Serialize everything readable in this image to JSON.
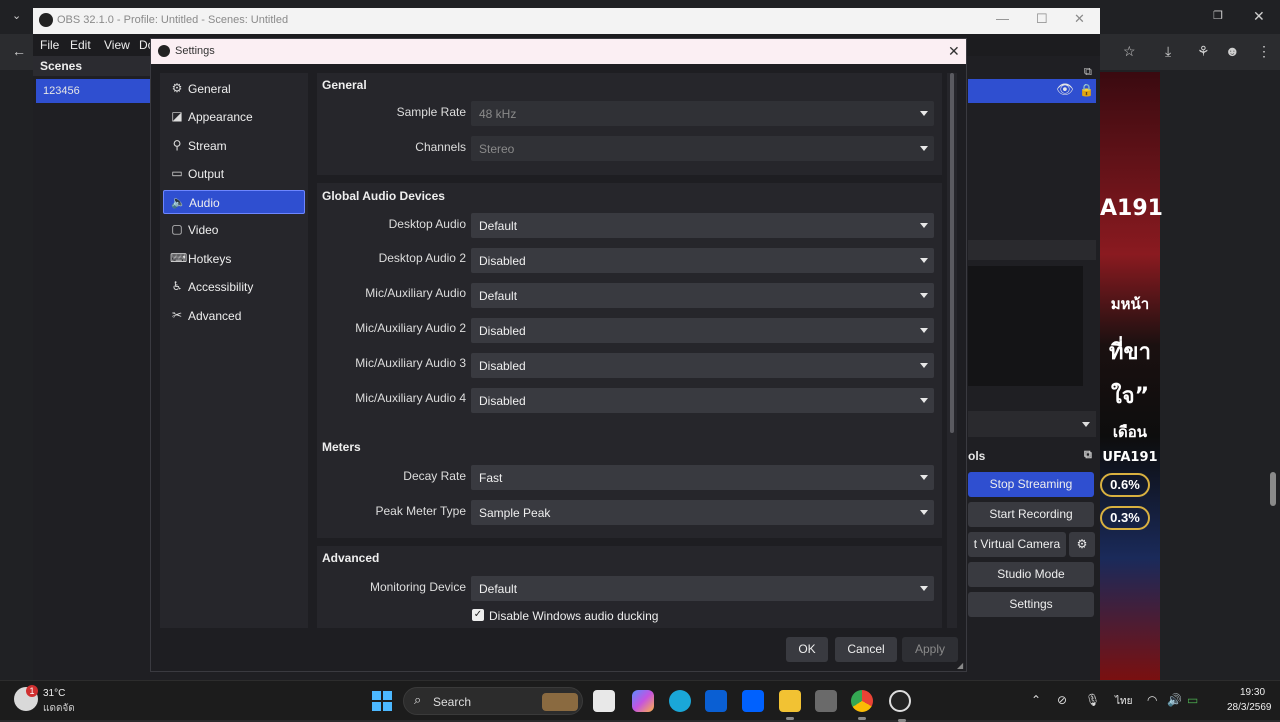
{
  "obs": {
    "title": "OBS 32.1.0 - Profile: Untitled - Scenes: Untitled",
    "menu": [
      "File",
      "Edit",
      "View",
      "Do"
    ],
    "scenes_header": "Scenes",
    "scene_item": "123456",
    "controls_header": "ols",
    "controls": [
      "Stop Streaming",
      "Start Recording",
      "t Virtual Camera",
      "Studio Mode",
      "Settings"
    ]
  },
  "settings": {
    "title": "Settings",
    "nav": [
      {
        "label": "General",
        "icon": "gear-icon",
        "glyph": "⚙"
      },
      {
        "label": "Appearance",
        "icon": "paint-icon",
        "glyph": "◪"
      },
      {
        "label": "Stream",
        "icon": "antenna-icon",
        "glyph": "⚲"
      },
      {
        "label": "Output",
        "icon": "output-icon",
        "glyph": "▭"
      },
      {
        "label": "Audio",
        "icon": "speaker-icon",
        "glyph": "🔈"
      },
      {
        "label": "Video",
        "icon": "monitor-icon",
        "glyph": "▢"
      },
      {
        "label": "Hotkeys",
        "icon": "keyboard-icon",
        "glyph": "⌨"
      },
      {
        "label": "Accessibility",
        "icon": "accessibility-icon",
        "glyph": "♿"
      },
      {
        "label": "Advanced",
        "icon": "wrench-icon",
        "glyph": "✂"
      }
    ],
    "selected_nav": "Audio",
    "general": {
      "title": "General",
      "sample_rate_label": "Sample Rate",
      "sample_rate": "48 kHz",
      "channels_label": "Channels",
      "channels": "Stereo"
    },
    "devices": {
      "title": "Global Audio Devices",
      "rows": [
        {
          "label": "Desktop Audio",
          "value": "Default"
        },
        {
          "label": "Desktop Audio 2",
          "value": "Disabled"
        },
        {
          "label": "Mic/Auxiliary Audio",
          "value": "Default"
        },
        {
          "label": "Mic/Auxiliary Audio 2",
          "value": "Disabled"
        },
        {
          "label": "Mic/Auxiliary Audio 3",
          "value": "Disabled"
        },
        {
          "label": "Mic/Auxiliary Audio 4",
          "value": "Disabled"
        }
      ]
    },
    "meters": {
      "title": "Meters",
      "decay_label": "Decay Rate",
      "decay": "Fast",
      "peak_label": "Peak Meter Type",
      "peak": "Sample Peak"
    },
    "advanced": {
      "title": "Advanced",
      "monitoring_label": "Monitoring Device",
      "monitoring": "Default",
      "ducking_label": "Disable Windows audio ducking",
      "ducking_checked": true
    },
    "buttons": {
      "ok": "OK",
      "cancel": "Cancel",
      "apply": "Apply"
    }
  },
  "taskbar": {
    "weather_badge": "1",
    "temperature": "31°C",
    "condition": "แดดจัด",
    "search": "Search",
    "language": "ไทย",
    "time": "19:30",
    "date": "28/3/2569"
  },
  "ads": {
    "line1": "A191",
    "line2": "มหน้า",
    "line3": "ที่ขา",
    "line4": "ใจ”",
    "line5": "เดือน",
    "line6": "UFA191",
    "pill1": "0.6%",
    "pill2": "0.3%"
  }
}
